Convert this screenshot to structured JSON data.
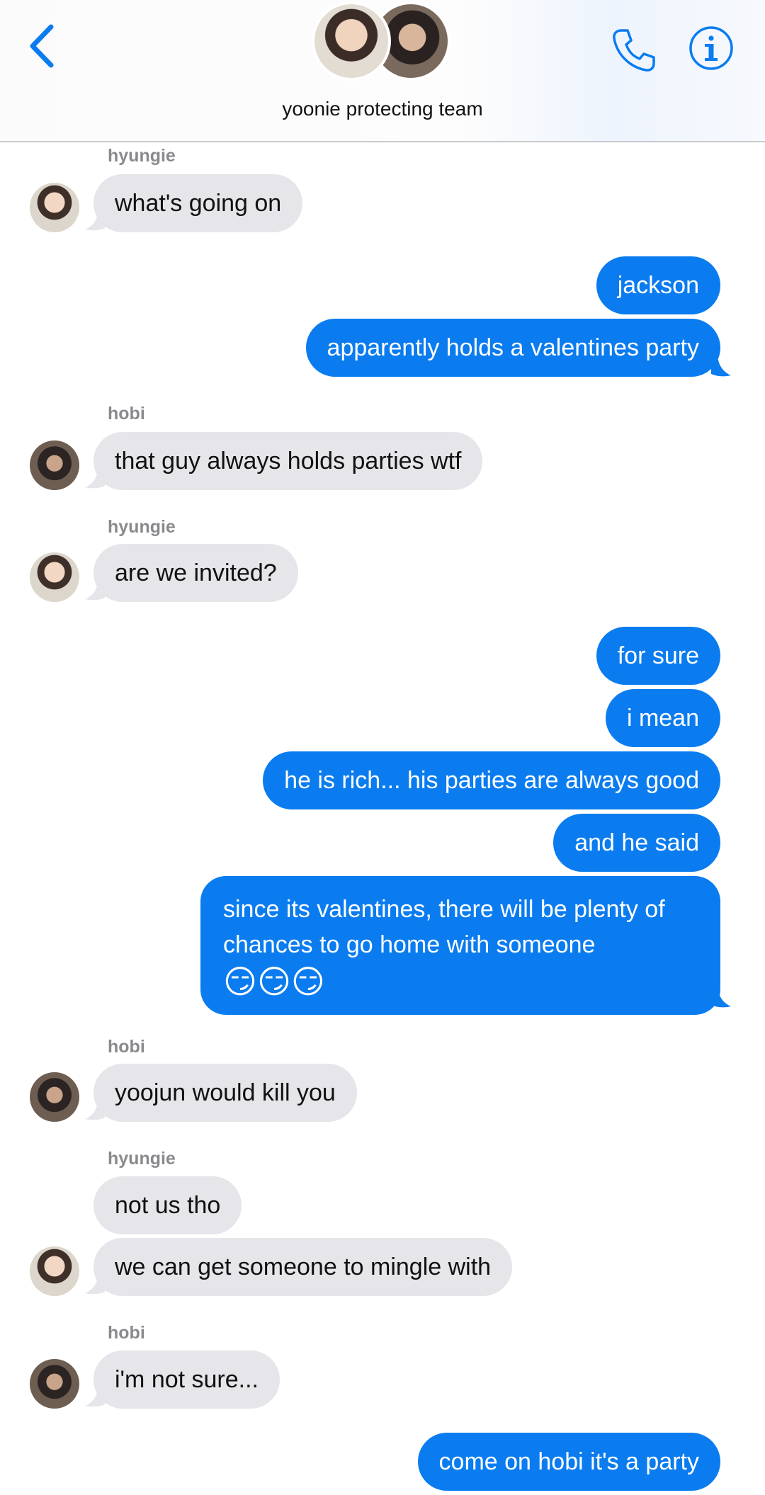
{
  "header": {
    "back_icon": "chevron-left-icon",
    "group_name": "yoonie protecting team",
    "call_icon": "phone-icon",
    "info_icon": "info-icon",
    "accent_color": "#0a7cf0"
  },
  "messages": [
    {
      "sender": "hyungie",
      "text": "what's going on"
    },
    {
      "text": "jackson"
    },
    {
      "text": "apparently holds a valentines party"
    },
    {
      "sender": "hobi",
      "text": "that guy always holds parties wtf"
    },
    {
      "sender": "hyungie",
      "text": "are we invited?"
    },
    {
      "text": "for sure"
    },
    {
      "text": "i mean"
    },
    {
      "text": "he is rich... his parties are always good"
    },
    {
      "text": "and he said"
    },
    {
      "text": "since its valentines, there will be plenty of chances to go home with someone",
      "emoji": "😏😏😏"
    },
    {
      "sender": "hobi",
      "text": "yoojun would kill you"
    },
    {
      "sender": "hyungie",
      "text": "not us tho"
    },
    {
      "text": "we can get someone to mingle with"
    },
    {
      "sender": "hobi",
      "text": "i'm not sure..."
    },
    {
      "text": "come on hobi it's a party"
    }
  ],
  "colors": {
    "incoming_bubble": "#e5e5ea",
    "outgoing_bubble": "#0a7cf0",
    "sender_label": "#8a8a8e"
  }
}
